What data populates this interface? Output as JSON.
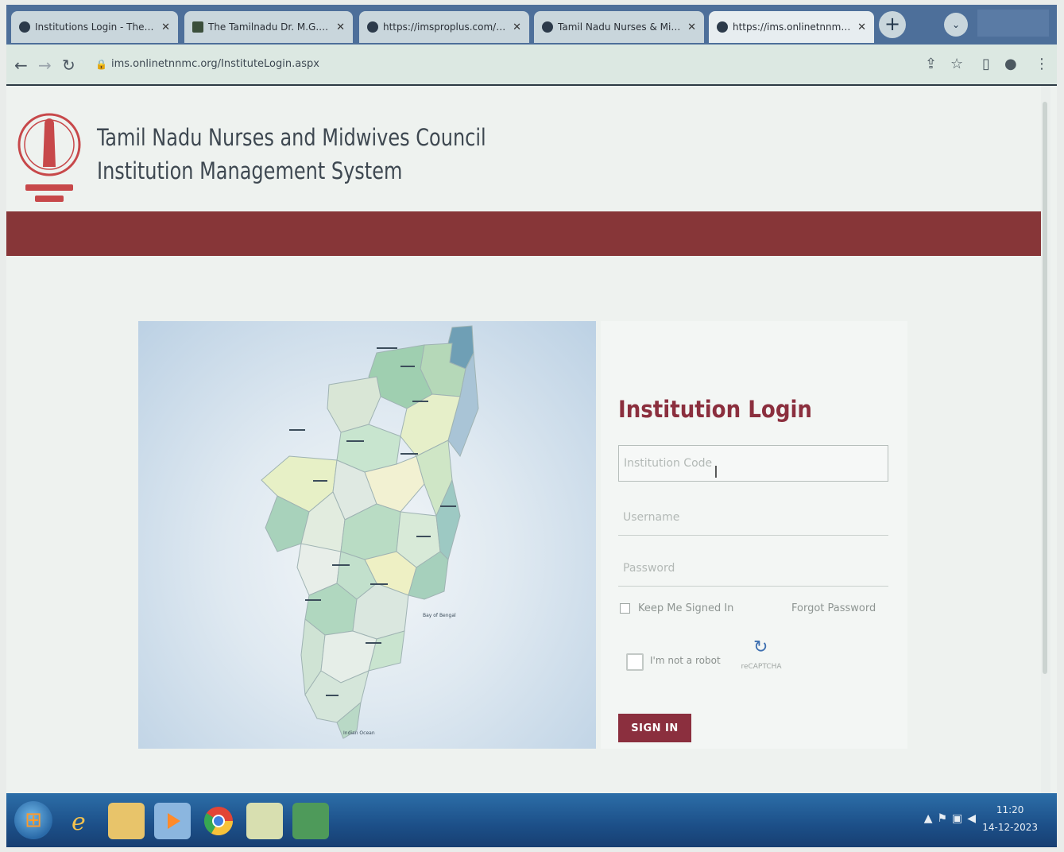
{
  "browser": {
    "tabs": [
      {
        "label": "Institutions Login - The Tamil",
        "active": false,
        "favicon": "logo-icon"
      },
      {
        "label": "The Tamilnadu Dr. M.G.R. Me",
        "active": false,
        "favicon": "document-icon"
      },
      {
        "label": "https://imsproplus.com/INDI",
        "active": false,
        "favicon": "globe-icon"
      },
      {
        "label": "Tamil Nadu Nurses & Midwi",
        "active": false,
        "favicon": "globe-icon"
      },
      {
        "label": "https://ims.onlinetnnmc.org/",
        "active": true,
        "favicon": "globe-icon"
      }
    ],
    "address": "ims.onlinetnnmc.org/InstituteLogin.aspx"
  },
  "header": {
    "line1": "Tamil Nadu Nurses and Midwives Council",
    "line2": "Institution Management System",
    "band_color": "#873638"
  },
  "map": {
    "labels": [
      "Bay of Bengal",
      "Indian Ocean"
    ]
  },
  "login": {
    "title": "Institution Login",
    "institution_code_placeholder": "Institution Code",
    "username_placeholder": "Username",
    "password_placeholder": "Password",
    "keep_signed_in": "Keep Me Signed In",
    "forgot_password": "Forgot Password",
    "captcha_label": "I'm not a robot",
    "captcha_brand": "reCAPTCHA",
    "signin_label": "SIGN IN",
    "accent_color": "#8b2f3e"
  },
  "taskbar": {
    "time": "11:20",
    "date": "14-12-2023"
  }
}
